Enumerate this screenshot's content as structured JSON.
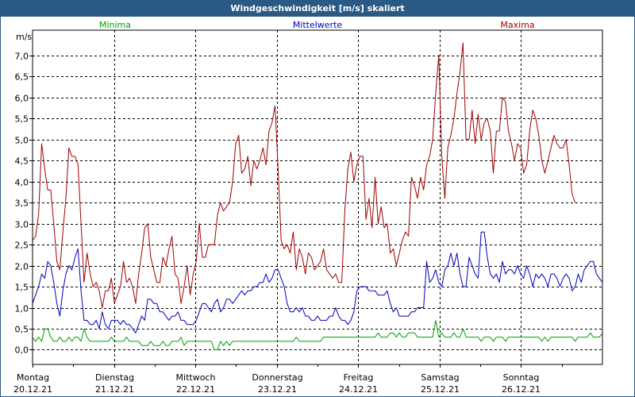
{
  "window": {
    "title": "Windgeschwindigkeit [m/s] skaliert"
  },
  "chart_data": {
    "type": "line",
    "title": "Windgeschwindigkeit [m/s] skaliert",
    "ylabel": "m/s",
    "ylim": [
      -0.35,
      7.6
    ],
    "y_ticks": [
      "0,0",
      "0,5",
      "1,0",
      "1,5",
      "2,0",
      "2,5",
      "3,0",
      "3,5",
      "4,0",
      "4,5",
      "5,0",
      "5,5",
      "6,0",
      "6,5",
      "7,0"
    ],
    "x_ticks": [
      {
        "day": "Montag",
        "date": "20.12.21"
      },
      {
        "day": "Dienstag",
        "date": "21.12.21"
      },
      {
        "day": "Mittwoch",
        "date": "22.12.21"
      },
      {
        "day": "Donnerstag",
        "date": "23.12.21"
      },
      {
        "day": "Freitag",
        "date": "24.12.21"
      },
      {
        "day": "Samstag",
        "date": "25.12.21"
      },
      {
        "day": "Sonntag",
        "date": "26.12.21"
      }
    ],
    "grid": true,
    "series": [
      {
        "name": "Minima",
        "color": "#00a000",
        "values": [
          0.3,
          0.2,
          0.3,
          0.2,
          0.5,
          0.5,
          0.3,
          0.2,
          0.2,
          0.3,
          0.2,
          0.2,
          0.3,
          0.2,
          0.3,
          0.3,
          0.2,
          0.5,
          0.3,
          0.2,
          0.2,
          0.2,
          0.2,
          0.2,
          0.2,
          0.2,
          0.3,
          0.2,
          0.2,
          0.2,
          0.2,
          0.3,
          0.2,
          0.2,
          0.2,
          0.2,
          0.1,
          0.1,
          0.1,
          0.2,
          0.1,
          0.1,
          0.1,
          0.2,
          0.1,
          0.1,
          0.2,
          0.2,
          0.2,
          0.3,
          0.1,
          0.2,
          0.2,
          0.2,
          0.2,
          0.2,
          0.2,
          0.2,
          0.2,
          0.2,
          0.0,
          0.0,
          0.2,
          0.1,
          0.2,
          0.1,
          0.2,
          0.2,
          0.2,
          0.2,
          0.2,
          0.2,
          0.2,
          0.2,
          0.2,
          0.2,
          0.2,
          0.2,
          0.2,
          0.2,
          0.2,
          0.2,
          0.2,
          0.2,
          0.2,
          0.2,
          0.2,
          0.3,
          0.2,
          0.2,
          0.2,
          0.2,
          0.2,
          0.2,
          0.2,
          0.2,
          0.3,
          0.3,
          0.3,
          0.3,
          0.3,
          0.3,
          0.3,
          0.3,
          0.3,
          0.3,
          0.3,
          0.3,
          0.3,
          0.3,
          0.3,
          0.3,
          0.3,
          0.3,
          0.4,
          0.3,
          0.3,
          0.3,
          0.4,
          0.4,
          0.3,
          0.4,
          0.3,
          0.3,
          0.4,
          0.4,
          0.4,
          0.3,
          0.3,
          0.3,
          0.3,
          0.3,
          0.3,
          0.7,
          0.3,
          0.4,
          0.3,
          0.3,
          0.3,
          0.4,
          0.3,
          0.3,
          0.5,
          0.3,
          0.3,
          0.3,
          0.3,
          0.3,
          0.2,
          0.3,
          0.3,
          0.3,
          0.2,
          0.3,
          0.3,
          0.3,
          0.2,
          0.3,
          0.3,
          0.3,
          0.3,
          0.3,
          0.3,
          0.3,
          0.3,
          0.3,
          0.3,
          0.3,
          0.2,
          0.3,
          0.2,
          0.3,
          0.3,
          0.3,
          0.3,
          0.3,
          0.3,
          0.3,
          0.3,
          0.2,
          0.3,
          0.3,
          0.3,
          0.3,
          0.4,
          0.3,
          0.3,
          0.3,
          0.4
        ]
      },
      {
        "name": "Mittelwerte",
        "color": "#0000c0",
        "values": [
          1.1,
          1.3,
          1.5,
          1.8,
          1.7,
          2.1,
          2.0,
          1.6,
          1.1,
          0.8,
          1.4,
          1.8,
          2.0,
          1.9,
          2.2,
          2.4,
          1.4,
          0.7,
          0.7,
          0.6,
          0.6,
          0.7,
          0.5,
          0.9,
          0.6,
          0.5,
          0.7,
          0.7,
          0.7,
          0.6,
          0.7,
          0.6,
          0.6,
          0.5,
          0.4,
          0.6,
          0.8,
          0.7,
          1.2,
          1.2,
          1.1,
          1.1,
          0.9,
          0.9,
          0.8,
          0.7,
          0.8,
          0.8,
          0.9,
          0.7,
          0.7,
          0.6,
          0.6,
          0.6,
          0.7,
          0.9,
          1.1,
          1.1,
          1.0,
          0.9,
          1.1,
          1.2,
          0.9,
          1.0,
          1.2,
          1.2,
          1.1,
          1.2,
          1.3,
          1.4,
          1.3,
          1.4,
          1.4,
          1.5,
          1.5,
          1.6,
          1.6,
          1.8,
          1.6,
          1.7,
          1.9,
          1.9,
          1.7,
          1.5,
          1.1,
          0.9,
          0.9,
          1.0,
          0.9,
          1.0,
          0.8,
          0.8,
          0.7,
          0.7,
          0.8,
          0.7,
          0.7,
          0.7,
          0.8,
          0.8,
          1.0,
          0.8,
          0.7,
          0.7,
          0.6,
          0.7,
          0.9,
          1.4,
          1.5,
          1.5,
          1.5,
          1.4,
          1.4,
          1.4,
          1.3,
          1.3,
          1.3,
          1.4,
          1.1,
          0.9,
          1.0,
          0.8,
          0.8,
          0.8,
          0.8,
          0.9,
          0.9,
          1.0,
          1.0,
          1.0,
          2.1,
          1.6,
          1.7,
          1.9,
          1.6,
          1.5,
          1.9,
          2.0,
          2.3,
          2.0,
          2.3,
          1.8,
          1.5,
          1.5,
          2.2,
          2.0,
          1.8,
          1.7,
          2.8,
          2.8,
          2.2,
          1.8,
          1.7,
          1.8,
          1.6,
          2.1,
          1.8,
          1.9,
          1.9,
          1.8,
          2.0,
          1.8,
          1.7,
          2.0,
          1.8,
          1.5,
          1.8,
          1.7,
          1.8,
          1.7,
          1.5,
          1.8,
          1.8,
          1.7,
          1.5,
          1.7,
          1.8,
          1.7,
          1.4,
          1.5,
          1.8,
          1.6,
          1.9,
          2.0,
          2.1,
          2.1,
          1.8,
          1.7,
          1.6
        ]
      },
      {
        "name": "Maxima",
        "color": "#a00000",
        "values": [
          2.6,
          2.7,
          3.2,
          4.9,
          4.3,
          3.8,
          3.8,
          3.0,
          2.1,
          1.9,
          2.8,
          3.6,
          4.8,
          4.6,
          4.6,
          4.4,
          3.0,
          1.6,
          2.3,
          1.8,
          1.5,
          1.6,
          1.4,
          1.0,
          1.4,
          1.4,
          1.7,
          1.1,
          1.3,
          1.5,
          2.1,
          1.6,
          1.7,
          1.5,
          1.1,
          1.8,
          2.3,
          2.9,
          3.0,
          2.2,
          1.9,
          1.6,
          1.6,
          2.2,
          2.0,
          2.4,
          2.7,
          1.8,
          1.7,
          1.1,
          1.5,
          2.0,
          1.3,
          1.8,
          2.1,
          3.0,
          2.2,
          2.2,
          2.5,
          2.5,
          2.5,
          3.2,
          3.5,
          3.3,
          3.4,
          3.5,
          4.0,
          4.9,
          5.1,
          4.2,
          4.3,
          4.6,
          3.9,
          4.5,
          4.3,
          4.5,
          4.8,
          4.4,
          5.2,
          5.4,
          5.8,
          4.3,
          2.6,
          2.4,
          2.5,
          2.3,
          2.8,
          1.9,
          2.4,
          2.2,
          1.8,
          2.3,
          2.2,
          1.9,
          2.0,
          2.1,
          2.4,
          1.9,
          1.8,
          1.7,
          1.8,
          1.6,
          1.6,
          3.3,
          4.3,
          4.7,
          4.0,
          4.4,
          4.6,
          4.6,
          3.1,
          3.6,
          2.9,
          4.1,
          3.0,
          3.4,
          2.9,
          3.0,
          2.3,
          2.4,
          2.0,
          2.3,
          2.6,
          2.8,
          2.7,
          4.1,
          3.9,
          3.6,
          4.1,
          3.8,
          4.4,
          4.6,
          5.0,
          6.1,
          7.0,
          4.6,
          3.6,
          4.8,
          5.1,
          5.5,
          6.1,
          6.6,
          7.3,
          5.0,
          5.0,
          5.7,
          4.9,
          5.6,
          5.0,
          5.4,
          5.5,
          5.2,
          4.2,
          5.2,
          5.2,
          6.0,
          5.9,
          5.2,
          4.9,
          4.5,
          4.9,
          4.8,
          4.2,
          4.4,
          5.2,
          5.7,
          5.5,
          5.1,
          4.5,
          4.2,
          4.5,
          4.8,
          5.1,
          4.9,
          4.8,
          4.8,
          5.0,
          4.4,
          3.7,
          3.5
        ]
      }
    ]
  }
}
